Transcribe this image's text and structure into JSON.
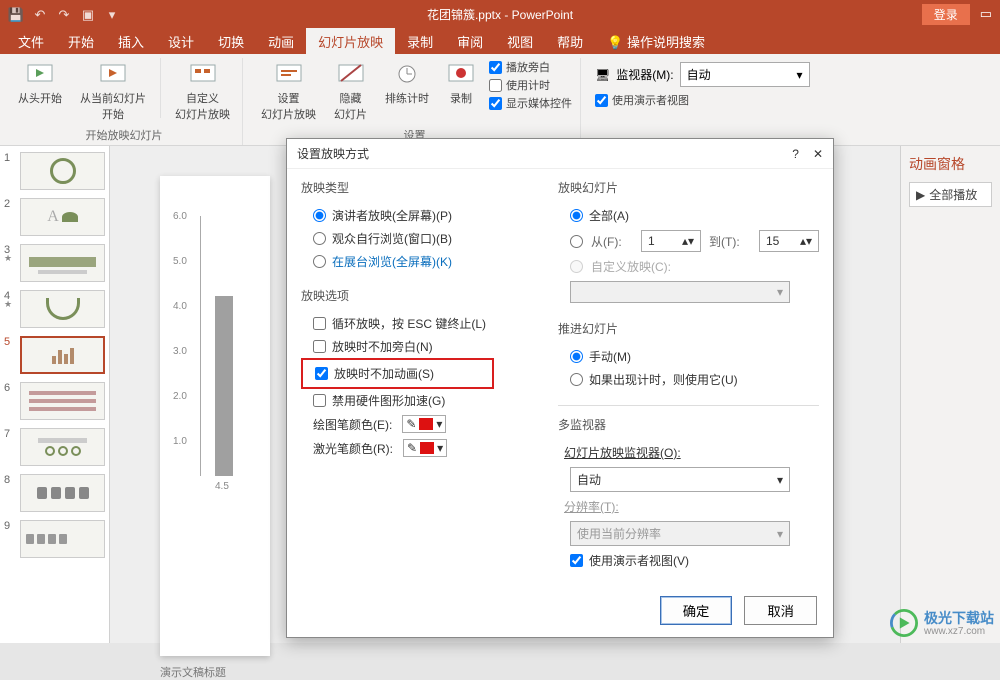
{
  "titlebar": {
    "title": "花团锦簇.pptx - PowerPoint",
    "login": "登录"
  },
  "tabs": [
    "文件",
    "开始",
    "插入",
    "设计",
    "切换",
    "动画",
    "幻灯片放映",
    "录制",
    "审阅",
    "视图",
    "帮助"
  ],
  "tell_me": "操作说明搜索",
  "ribbon": {
    "from_begin": "从头开始",
    "from_current": "从当前幻灯片\n开始",
    "custom": "自定义\n幻灯片放映",
    "setup": "设置\n幻灯片放映",
    "hide": "隐藏\n幻灯片",
    "rehearse": "排练计时",
    "record": "录制",
    "play_narr": "播放旁白",
    "use_timing": "使用计时",
    "show_media": "显示媒体控件",
    "monitor_label": "监视器(M):",
    "monitor_value": "自动",
    "presenter_view": "使用演示者视图",
    "group1": "开始放映幻灯片",
    "group2": "设置"
  },
  "dialog": {
    "title": "设置放映方式",
    "help": "?",
    "close": "✕",
    "show_type": "放映类型",
    "opt_presenter": "演讲者放映(全屏幕)(P)",
    "opt_browse": "观众自行浏览(窗口)(B)",
    "opt_kiosk": "在展台浏览(全屏幕)(K)",
    "show_options": "放映选项",
    "loop": "循环放映，按 ESC 键终止(L)",
    "no_narr": "放映时不加旁白(N)",
    "no_anim": "放映时不加动画(S)",
    "no_hw": "禁用硬件图形加速(G)",
    "pen_label": "绘图笔颜色(E):",
    "laser_label": "激光笔颜色(R):",
    "show_slides": "放映幻灯片",
    "all": "全部(A)",
    "from": "从(F):",
    "to": "到(T):",
    "from_val": "1",
    "to_val": "15",
    "custom_show": "自定义放映(C):",
    "advance": "推进幻灯片",
    "manual": "手动(M)",
    "timings": "如果出现计时，则使用它(U)",
    "multimonitor": "多监视器",
    "mon_label": "幻灯片放映监视器(O):",
    "mon_value": "自动",
    "res_label": "分辨率(T):",
    "res_value": "使用当前分辨率",
    "use_pv": "使用演示者视图(V)",
    "ok": "确定",
    "cancel": "取消"
  },
  "anim": {
    "title": "动画窗格",
    "play": "全部播放"
  },
  "slide_footer": "演示文稿标题",
  "watermark": {
    "name": "极光下载站",
    "url": "www.xz7.com"
  },
  "chart_data": {
    "type": "bar",
    "y_ticks": [
      "6.0",
      "5.0",
      "4.0",
      "3.0",
      "2.0",
      "1.0"
    ],
    "x_label": "4.5",
    "values": [
      4.5
    ],
    "ylim": [
      0,
      6.5
    ]
  },
  "thumbs": {
    "count": 9,
    "selected": 5,
    "starred": [
      3,
      4
    ]
  }
}
